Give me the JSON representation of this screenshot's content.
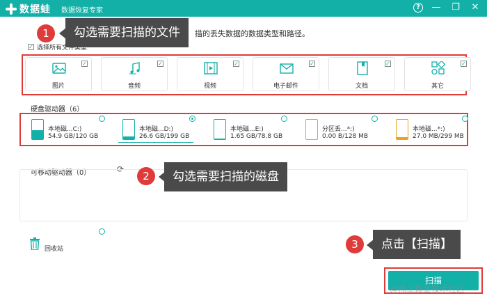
{
  "app": {
    "name": "数据蛙",
    "subtitle": "数据恢复专家",
    "help_glyph": "?",
    "minimize_glyph": "—",
    "restore_glyph": "❐",
    "close_glyph": "✕"
  },
  "instruction": "描的丢失数据的数据类型和路径。",
  "select_all": "选择所有文件类型",
  "file_types": [
    {
      "label": "图片",
      "icon": "image-icon",
      "checked": true
    },
    {
      "label": "音频",
      "icon": "music-icon",
      "checked": true
    },
    {
      "label": "视频",
      "icon": "video-icon",
      "checked": true
    },
    {
      "label": "电子邮件",
      "icon": "mail-icon",
      "checked": true
    },
    {
      "label": "文档",
      "icon": "document-icon",
      "checked": true
    },
    {
      "label": "其它",
      "icon": "other-icon",
      "checked": true
    }
  ],
  "hard_drives": {
    "title": "硬盘驱动器（6）",
    "items": [
      {
        "name": "本地磁...C:)",
        "size": "54.9 GB/120 GB",
        "selected": false,
        "used_fraction": 0.46,
        "color": "#13b0a8"
      },
      {
        "name": "本地磁...D:)",
        "size": "26.6 GB/199 GB",
        "selected": true,
        "used_fraction": 0.13,
        "color": "#13b0a8"
      },
      {
        "name": "本地磁...E:)",
        "size": "1.65 GB/78.8 GB",
        "selected": false,
        "used_fraction": 0.02,
        "color": "#13b0a8"
      },
      {
        "name": "分区丢...*:)",
        "size": "0.00  B/128 MB",
        "selected": false,
        "used_fraction": 0.0,
        "color": "#f0a020"
      },
      {
        "name": "本地磁...*:)",
        "size": "27.0 MB/299 MB",
        "selected": false,
        "used_fraction": 0.09,
        "color": "#f0a020"
      }
    ]
  },
  "removable": {
    "title": "可移动驱动器（0）",
    "refresh_glyph": "⟳"
  },
  "recycle_bin": "回收站",
  "scan_button": "扫描",
  "callouts": [
    {
      "number": "1",
      "text": "勾选需要扫描的文件"
    },
    {
      "number": "2",
      "text": "勾选需要扫描的磁盘"
    },
    {
      "number": "3",
      "text": "点击【扫描】"
    }
  ],
  "watermark": "@稀土掘金技术社区",
  "colors": {
    "accent": "#13b0a8",
    "highlight": "#e03b3b",
    "callout_bg": "#4a4a4a"
  }
}
